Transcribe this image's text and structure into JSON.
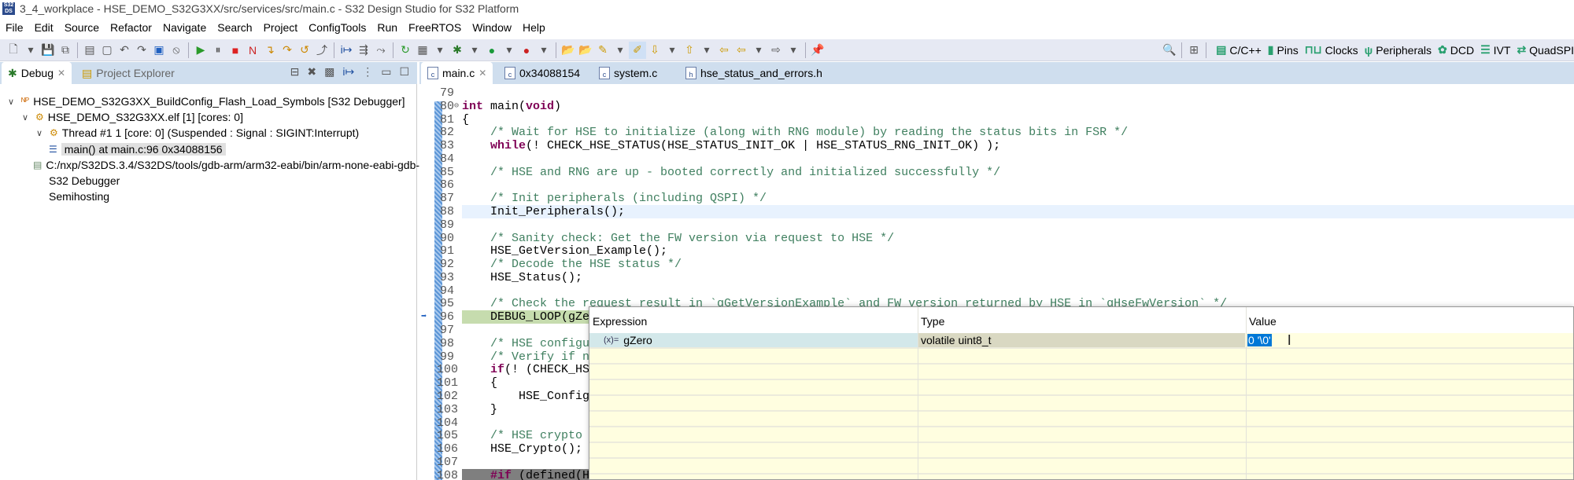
{
  "window": {
    "title": "3_4_workplace - HSE_DEMO_S32G3XX/src/services/src/main.c - S32 Design Studio for S32 Platform",
    "logo": "S32 DS"
  },
  "menu": [
    "File",
    "Edit",
    "Source",
    "Refactor",
    "Navigate",
    "Search",
    "Project",
    "ConfigTools",
    "Run",
    "FreeRTOS",
    "Window",
    "Help"
  ],
  "perspectives": [
    "C/C++",
    "Pins",
    "Clocks",
    "Peripherals",
    "DCD",
    "IVT",
    "QuadSPI"
  ],
  "left_tabs": {
    "debug": "Debug",
    "explorer": "Project Explorer"
  },
  "tree": [
    {
      "label": "HSE_DEMO_S32G3XX_BuildConfig_Flash_Load_Symbols [S32 Debugger]",
      "icon": "launch-icon"
    },
    {
      "label": "HSE_DEMO_S32G3XX.elf [1] [cores: 0]",
      "icon": "process-icon"
    },
    {
      "label": "Thread #1 1 [core: 0] (Suspended : Signal : SIGINT:Interrupt)",
      "icon": "thread-icon"
    },
    {
      "label": "main() at main.c:96 0x34088156",
      "icon": "stack-frame-icon"
    },
    {
      "label": "C:/nxp/S32DS.3.4/S32DS/tools/gdb-arm/arm32-eabi/bin/arm-none-eabi-gdb-",
      "icon": "gdb-icon"
    },
    {
      "label": "S32 Debugger",
      "icon": "none"
    },
    {
      "label": "Semihosting",
      "icon": "none"
    }
  ],
  "editor_tabs": [
    "main.c",
    "0x34088154",
    "system.c",
    "hse_status_and_errors.h"
  ],
  "code": [
    {
      "n": "79",
      "s": []
    },
    {
      "n": "80",
      "s": [
        {
          "k": "kw",
          "t": "int"
        },
        {
          "k": "tx",
          "t": " main("
        },
        {
          "k": "kw",
          "t": "void"
        },
        {
          "k": "tx",
          "t": ")"
        }
      ]
    },
    {
      "n": "81",
      "s": [
        {
          "k": "tx",
          "t": "{"
        }
      ]
    },
    {
      "n": "82",
      "s": [
        {
          "k": "cm",
          "t": "    /* Wait for HSE to initialize (along with RNG module) by reading the status bits in FSR */"
        }
      ]
    },
    {
      "n": "83",
      "s": [
        {
          "k": "kw",
          "t": "    while"
        },
        {
          "k": "tx",
          "t": "(! CHECK_HSE_STATUS(HSE_STATUS_INIT_OK | HSE_STATUS_RNG_INIT_OK) );"
        }
      ]
    },
    {
      "n": "84",
      "s": []
    },
    {
      "n": "85",
      "s": [
        {
          "k": "cm",
          "t": "    /* HSE and RNG are up - booted correctly and initialized successfully */"
        }
      ]
    },
    {
      "n": "86",
      "s": []
    },
    {
      "n": "87",
      "s": [
        {
          "k": "cm",
          "t": "    /* Init peripherals (including QSPI) */"
        }
      ]
    },
    {
      "n": "88",
      "s": [
        {
          "k": "tx",
          "t": "    Init_Peripherals();"
        }
      ]
    },
    {
      "n": "89",
      "s": []
    },
    {
      "n": "90",
      "s": [
        {
          "k": "cm",
          "t": "    /* Sanity check: Get the FW version via request to HSE */"
        }
      ]
    },
    {
      "n": "91",
      "s": [
        {
          "k": "tx",
          "t": "    HSE_GetVersion_Example();"
        }
      ]
    },
    {
      "n": "92",
      "s": [
        {
          "k": "cm",
          "t": "    /* Decode the HSE status */"
        }
      ]
    },
    {
      "n": "93",
      "s": [
        {
          "k": "tx",
          "t": "    HSE_Status();"
        }
      ]
    },
    {
      "n": "94",
      "s": []
    },
    {
      "n": "95",
      "s": [
        {
          "k": "cm",
          "t": "    /* Check the request result in `gGetVersionExample` and FW version returned by HSE in `gHseFwVersion` */"
        }
      ]
    },
    {
      "n": "96",
      "s": [
        {
          "k": "tx",
          "t": "    DEBUG_LOOP(gZero)"
        }
      ]
    },
    {
      "n": "97",
      "s": []
    },
    {
      "n": "98",
      "s": [
        {
          "k": "cm",
          "t": "    /* HSE configurat"
        }
      ]
    },
    {
      "n": "99",
      "s": [
        {
          "k": "cm",
          "t": "    /* Verify if not"
        }
      ]
    },
    {
      "n": "100",
      "s": [
        {
          "k": "kw",
          "t": "    if"
        },
        {
          "k": "tx",
          "t": "(! (CHECK_HSE_S"
        }
      ]
    },
    {
      "n": "101",
      "s": [
        {
          "k": "tx",
          "t": "    {"
        }
      ]
    },
    {
      "n": "102",
      "s": [
        {
          "k": "tx",
          "t": "        HSE_Config();"
        }
      ]
    },
    {
      "n": "103",
      "s": [
        {
          "k": "tx",
          "t": "    }"
        }
      ]
    },
    {
      "n": "104",
      "s": []
    },
    {
      "n": "105",
      "s": [
        {
          "k": "cm",
          "t": "    /* HSE crypto exa"
        }
      ]
    },
    {
      "n": "106",
      "s": [
        {
          "k": "tx",
          "t": "    HSE_Crypto();"
        }
      ]
    },
    {
      "n": "107",
      "s": []
    },
    {
      "n": "108",
      "s": [
        {
          "k": "kw",
          "t": "    #if"
        },
        {
          "k": "tx",
          "t": " (defined(HSE"
        }
      ]
    }
  ],
  "popup": {
    "headers": {
      "expression": "Expression",
      "type": "Type",
      "value": "Value"
    },
    "row": {
      "icon": "(x)=",
      "expression": "gZero",
      "type": "volatile uint8_t",
      "value": "0 '\\0'"
    }
  }
}
